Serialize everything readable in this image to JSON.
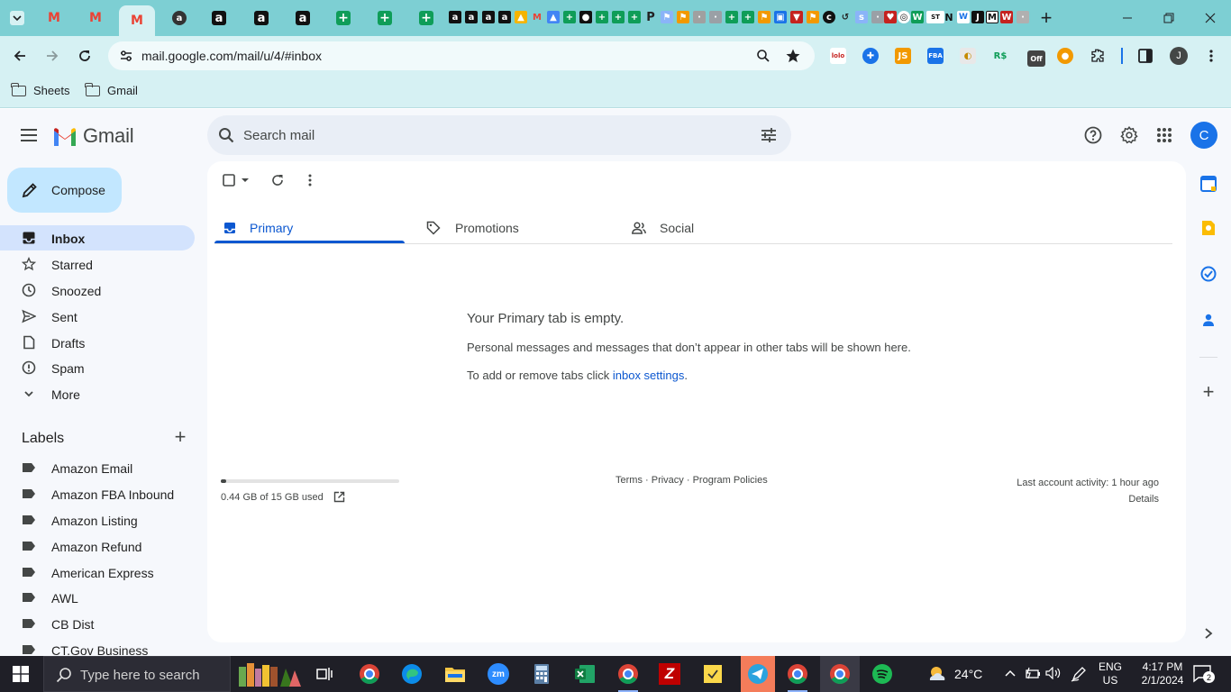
{
  "browser": {
    "url": "mail.google.com/mail/u/4/#inbox",
    "bookmarks": [
      "Sheets",
      "Gmail"
    ],
    "profile_initial": "J"
  },
  "gmail": {
    "wordmark": "Gmail",
    "search_placeholder": "Search mail",
    "account_initial": "C",
    "compose_label": "Compose",
    "nav": [
      {
        "label": "Inbox",
        "icon": "inbox-icon"
      },
      {
        "label": "Starred",
        "icon": "star-icon"
      },
      {
        "label": "Snoozed",
        "icon": "clock-icon"
      },
      {
        "label": "Sent",
        "icon": "send-icon"
      },
      {
        "label": "Drafts",
        "icon": "draft-icon"
      },
      {
        "label": "Spam",
        "icon": "spam-icon"
      },
      {
        "label": "More",
        "icon": "chevron-down-icon"
      }
    ],
    "labels_title": "Labels",
    "labels": [
      "Amazon Email",
      "Amazon FBA Inbound",
      "Amazon Listing",
      "Amazon Refund",
      "American Express",
      "AWL",
      "CB Dist",
      "CT.Gov Business"
    ],
    "tabs": [
      {
        "label": "Primary",
        "icon": "inbox-icon"
      },
      {
        "label": "Promotions",
        "icon": "tag-icon"
      },
      {
        "label": "Social",
        "icon": "people-icon"
      }
    ],
    "empty_title": "Your Primary tab is empty.",
    "empty_desc": "Personal messages and messages that don’t appear in other tabs will be shown here.",
    "empty_tabs_prefix": "To add or remove tabs click ",
    "empty_tabs_link": "inbox settings",
    "empty_tabs_suffix": ".",
    "storage_text": "0.44 GB of 15 GB used",
    "storage_fraction": 0.029,
    "footer": {
      "terms": "Terms",
      "privacy": "Privacy",
      "policies": "Program Policies",
      "sep": " · "
    },
    "activity": "Last account activity: 1 hour ago",
    "details": "Details",
    "accent": "#0b57d0",
    "compose_bg": "#c2e7ff"
  },
  "taskbar": {
    "search_placeholder": "Type here to search",
    "weather": "24°C",
    "lang1": "ENG",
    "lang2": "US",
    "time": "4:17 PM",
    "date": "2/1/2024",
    "notifications": "2"
  }
}
